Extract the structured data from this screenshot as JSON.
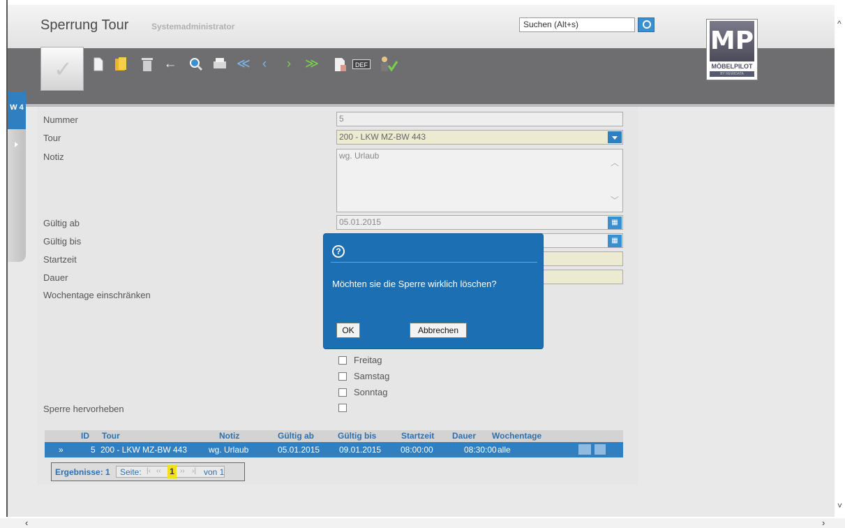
{
  "header": {
    "title": "Sperrung Tour",
    "subtitle": "Systemadministrator",
    "search_placeholder": "Suchen (Alt+s)"
  },
  "logo": {
    "mark": "MP",
    "name": "MÖBELPILOT",
    "sub": "BY REWIDATA"
  },
  "side_tab": {
    "label": "W 4"
  },
  "toolbar": {
    "def_label": "DEF",
    "icons": [
      "confirm-icon",
      "new-document-icon",
      "open-folder-icon",
      "delete-icon",
      "back-icon",
      "search-icon",
      "print-icon",
      "first-icon",
      "previous-icon",
      "next-icon",
      "last-icon",
      "document-icon",
      "def-icon",
      "user-check-icon"
    ]
  },
  "form": {
    "nummer_label": "Nummer",
    "nummer_value": "5",
    "tour_label": "Tour",
    "tour_value": "200 - LKW MZ-BW 443",
    "notiz_label": "Notiz",
    "notiz_value": "wg. Urlaub",
    "gueltig_ab_label": "Gültig ab",
    "gueltig_ab_value": "05.01.2015",
    "gueltig_bis_label": "Gültig bis",
    "startzeit_label": "Startzeit",
    "dauer_label": "Dauer",
    "wochentage_label": "Wochentage einschränken",
    "days": [
      "Freitag",
      "Samstag",
      "Sonntag"
    ],
    "sperre_label": "Sperre hervorheben"
  },
  "grid": {
    "columns": [
      "ID",
      "Tour",
      "Notiz",
      "Gültig ab",
      "Gültig bis",
      "Startzeit",
      "Dauer",
      "Wochentage"
    ],
    "rows": [
      {
        "marker": "»",
        "id": "5",
        "tour": "200 - LKW MZ-BW 443",
        "notiz": "wg. Urlaub",
        "gueltig_ab": "05.01.2015",
        "gueltig_bis": "09.01.2015",
        "startzeit": "08:00:00",
        "dauer": "08:30:00",
        "wochentage": "alle"
      }
    ]
  },
  "pager": {
    "results": "Ergebnisse: 1",
    "seite": "Seite:",
    "first": "|‹",
    "prev": "‹‹",
    "current": "1",
    "next": "››",
    "last": "›|",
    "of": "von 1"
  },
  "dialog": {
    "message": "Möchten sie die Sperre wirklich löschen?",
    "ok": "OK",
    "cancel": "Abbrechen"
  },
  "colors": {
    "accent": "#2f7fc1",
    "toolbar": "#6e6e70",
    "dialog": "#1d6fb3",
    "highlight": "#f1e01a"
  }
}
